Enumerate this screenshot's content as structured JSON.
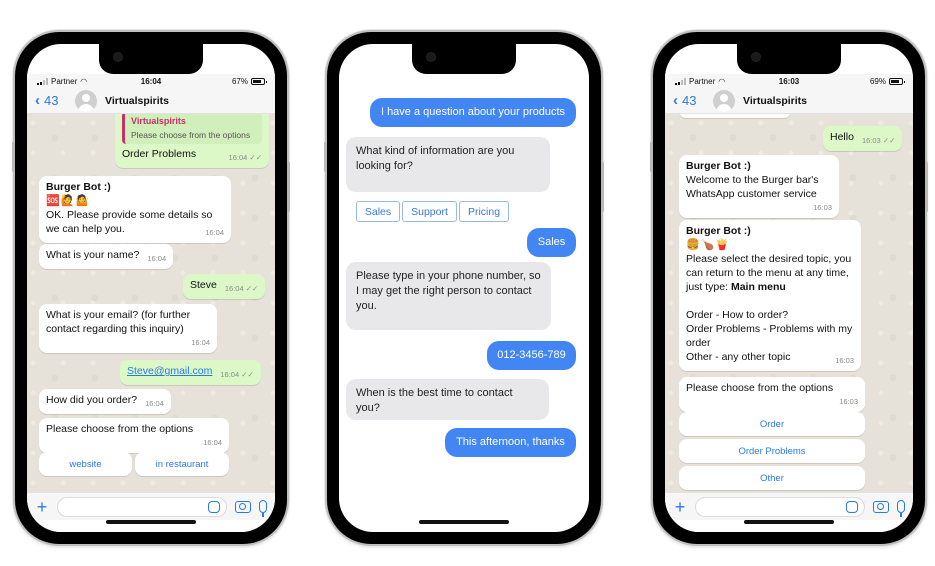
{
  "phones": [
    {
      "app": "WhatsApp",
      "status_bar": {
        "carrier": "Partner",
        "time": "16:04",
        "battery": "67%"
      },
      "header": {
        "back_count": "43",
        "contact_name": "Virtualspirits"
      },
      "messages": [
        {
          "direction": "out",
          "quote_name": "Virtualspirits",
          "quote_text": "Please choose from the options",
          "text": "Order Problems",
          "time": "16:04",
          "status": "read"
        },
        {
          "direction": "in",
          "sender": "Burger Bot :)",
          "emoji": "🆘🙋🤷",
          "text": "OK. Please provide some details so we can help you.",
          "time": "16:04"
        },
        {
          "direction": "in",
          "text": "What is your name?",
          "time": "16:04"
        },
        {
          "direction": "out",
          "text": "Steve",
          "time": "16:04",
          "status": "read"
        },
        {
          "direction": "in",
          "text": "What is your email? (for further contact regarding this inquiry)",
          "time": "16:04"
        },
        {
          "direction": "out",
          "text": "Steve@gmail.com",
          "time": "16:04",
          "status": "read",
          "is_link": true
        },
        {
          "direction": "in",
          "text": "How did you order?",
          "time": "16:04"
        },
        {
          "direction": "in",
          "text": "Please choose from the options",
          "time": "16:04"
        }
      ],
      "options": [
        "website",
        "in restaurant"
      ],
      "input": {
        "placeholder": ""
      }
    },
    {
      "app": "Web chat",
      "messages": [
        {
          "direction": "out",
          "text": "I have a question about your products"
        },
        {
          "direction": "in",
          "text": "What kind of information are you looking for?"
        },
        {
          "direction": "out",
          "text": "Sales"
        },
        {
          "direction": "in",
          "text": "Please type in your phone number, so I may get the right person to contact you."
        },
        {
          "direction": "out",
          "text": "012-3456-789"
        },
        {
          "direction": "in",
          "text": "When is the best time to contact you?"
        },
        {
          "direction": "out",
          "text": "This afternoon, thanks"
        }
      ],
      "quick_replies": [
        "Sales",
        "Support",
        "Pricing"
      ]
    },
    {
      "app": "WhatsApp",
      "status_bar": {
        "carrier": "Partner",
        "time": "16:03",
        "battery": "69%"
      },
      "header": {
        "back_count": "43",
        "contact_name": "Virtualspirits"
      },
      "messages": [
        {
          "direction": "out",
          "text": "Hello",
          "time": "16:03",
          "status": "read"
        },
        {
          "direction": "in",
          "sender": "Burger Bot :)",
          "text_lines": [
            "Welcome to the Burger bar's",
            "WhatsApp customer service"
          ],
          "time": "16:03"
        },
        {
          "direction": "in",
          "sender": "Burger Bot :)",
          "emoji": "🍔🍗🍟",
          "intro": "Please select the desired topic, you can return to the menu at any time, just type: ",
          "intro_bold": "Main menu",
          "menu": [
            "Order - How to order?",
            "Order Problems - Problems with my order",
            "Other - any other topic"
          ],
          "time": "16:03"
        },
        {
          "direction": "in",
          "text": "Please choose from the options",
          "time": "16:03"
        }
      ],
      "options": [
        "Order",
        "Order Problems",
        "Other"
      ],
      "input": {
        "placeholder": ""
      }
    }
  ],
  "colors": {
    "whatsapp_blue": "#2a7ae4",
    "whatsapp_outgoing": "#dcf8c6",
    "whatsapp_chat_bg": "#e7e2d9",
    "webchat_outgoing": "#4286f4",
    "webchat_incoming": "#e8e8ea",
    "quote_accent": "#c7306b"
  }
}
